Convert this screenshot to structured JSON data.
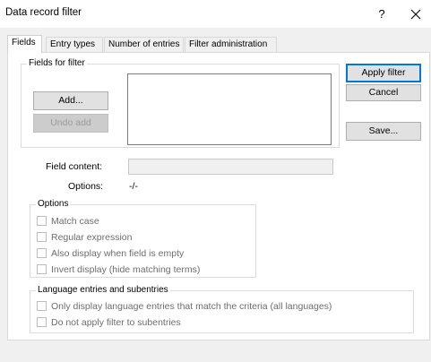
{
  "window": {
    "title": "Data record filter",
    "help_glyph": "?",
    "close_glyph": "✕"
  },
  "tabs": [
    {
      "label": "Fields",
      "active": true
    },
    {
      "label": "Entry types",
      "active": false
    },
    {
      "label": "Number of entries",
      "active": false
    },
    {
      "label": "Filter administration",
      "active": false
    }
  ],
  "fields_group": {
    "label": "Fields for filter",
    "add_label": "Add...",
    "undo_add_label": "Undo add"
  },
  "side_buttons": {
    "apply_label": "Apply filter",
    "cancel_label": "Cancel",
    "save_label": "Save..."
  },
  "field_content": {
    "label": "Field content:",
    "value": ""
  },
  "options_row": {
    "label": "Options:",
    "value": "-/-"
  },
  "options_group": {
    "label": "Options",
    "items": [
      {
        "label": "Match case",
        "checked": false
      },
      {
        "label": "Regular expression",
        "checked": false
      },
      {
        "label": "Also display when field is empty",
        "checked": false
      },
      {
        "label": "Invert display (hide matching terms)",
        "checked": false
      }
    ]
  },
  "language_group": {
    "label": "Language entries and subentries",
    "items": [
      {
        "label": "Only display language entries that match the criteria (all languages)",
        "checked": false
      },
      {
        "label": "Do not apply filter to subentries",
        "checked": false
      }
    ]
  }
}
